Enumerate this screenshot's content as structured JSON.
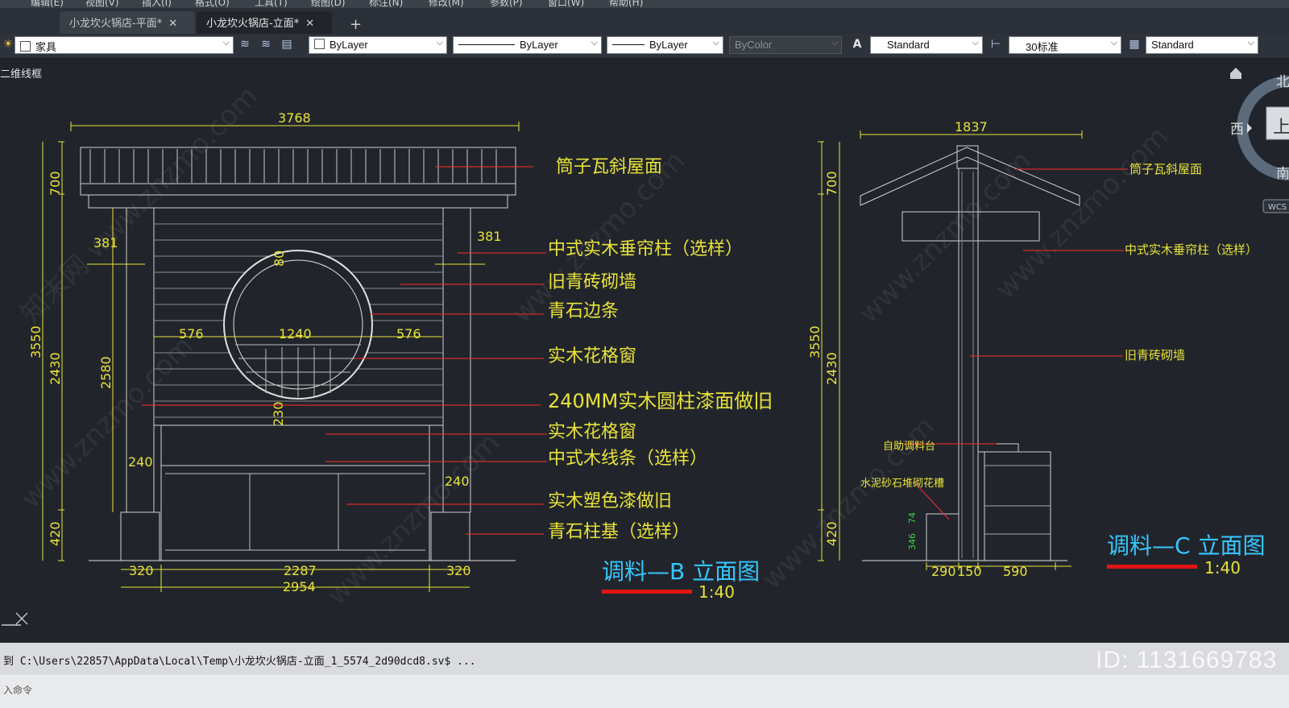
{
  "menu": [
    "编辑(E)",
    "视图(V)",
    "插入(I)",
    "格式(O)",
    "工具(T)",
    "绘图(D)",
    "标注(N)",
    "修改(M)",
    "参数(P)",
    "窗口(W)",
    "帮助(H)"
  ],
  "tabs": [
    {
      "label": "小龙坎火锅店-平面*",
      "close": "✕"
    },
    {
      "label": "小龙坎火锅店-立面*",
      "close": "✕"
    }
  ],
  "tab_add": "+",
  "toolbar": {
    "layer": "家具",
    "color": "ByLayer",
    "linetype": "ByLayer",
    "lineweight": "ByLayer",
    "plotstyle": "ByColor",
    "textstyle": "Standard",
    "dimstyle": "30标准",
    "tablestyle": "Standard"
  },
  "viewport_label": "二维线框",
  "viewcube": {
    "north": "北",
    "west": "西",
    "south": "南",
    "face": "上",
    "wcs": "WCS"
  },
  "drawing": {
    "b": {
      "dim_top": "3768",
      "dim_left_total": "3550",
      "dim_left_700": "700",
      "dim_left_2430": "2430",
      "dim_left_420": "420",
      "dim_2580": "2580",
      "dim_381_l": "381",
      "dim_381_r": "381",
      "dim_80": "80",
      "dim_576_l": "576",
      "dim_1240": "1240",
      "dim_576_r": "576",
      "dim_230": "230",
      "dim_240_l": "240",
      "dim_240_r": "240",
      "dim_320_l": "320",
      "dim_2287": "2287",
      "dim_320_r": "320",
      "dim_2954": "2954",
      "labels": [
        "筒子瓦斜屋面",
        "中式实木垂帘柱（选样）",
        "旧青砖砌墙",
        "青石边条",
        "实木花格窗",
        "240MM实木圆柱漆面做旧",
        "实木花格窗",
        "中式木线条（选样）",
        "实木塑色漆做旧",
        "青石柱基（选样）"
      ],
      "title": "调料—B 立面图",
      "scale": "1:40"
    },
    "c": {
      "dim_top": "1837",
      "dim_left_total": "3550",
      "dim_left_700": "700",
      "dim_left_2430": "2430",
      "dim_left_420": "420",
      "dim_74": "74",
      "dim_346": "346",
      "dim_290": "290",
      "dim_150": "150",
      "dim_590": "590",
      "labels": [
        "筒子瓦斜屋面",
        "中式实木垂帘柱（选样）",
        "旧青砖砌墙",
        "自助调料台",
        "水泥砂石堆砌花槽"
      ],
      "title": "调料—C 立面图",
      "scale": "1:40"
    }
  },
  "watermark_site": "www.znzmo.com",
  "watermark_cn": "知末网",
  "brand": "知末",
  "id_text": "ID: 1131669783",
  "command_line": "到 C:\\Users\\22857\\AppData\\Local\\Temp\\小龙坎火锅店-立面_1_5574_2d90dcd8.sv$ ...",
  "command_prompt": "入命令",
  "colors": {
    "dim": "#e8e23a",
    "leader": "#ff2a2a",
    "cyan": "#36c6ff",
    "green": "#39d640",
    "red": "#e01515"
  }
}
